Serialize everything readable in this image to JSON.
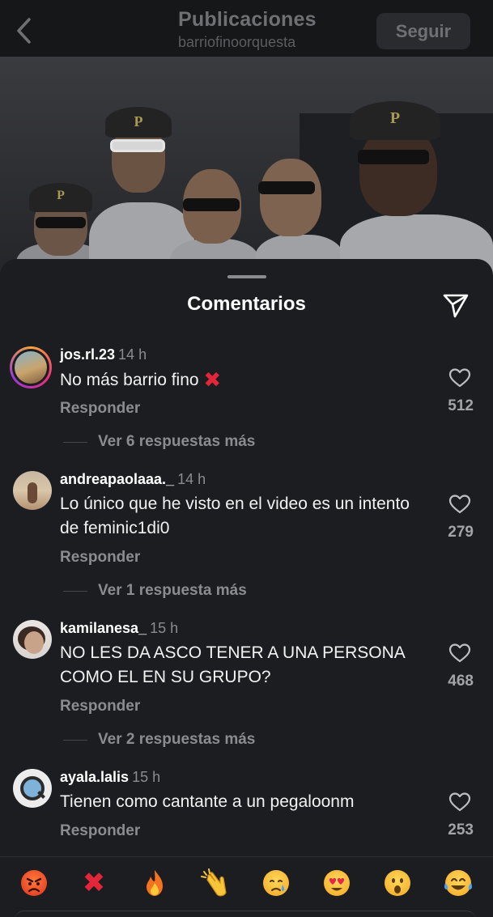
{
  "header": {
    "title": "Publicaciones",
    "subtitle": "barriofinoorquesta",
    "follow_label": "Seguir"
  },
  "sheet": {
    "title": "Comentarios"
  },
  "comments": [
    {
      "user": "jos.rl.23",
      "time": "14 h",
      "text": "No más barrio fino",
      "has_x_emoji": true,
      "reply_label": "Responder",
      "more_label": "Ver 6 respuestas más",
      "likes": "512"
    },
    {
      "user": "andreapaolaaa._",
      "time": "14 h",
      "text": "Lo único que he visto en el video es un intento de feminic1di0",
      "reply_label": "Responder",
      "more_label": "Ver 1 respuesta más",
      "likes": "279"
    },
    {
      "user": "kamilanesa_",
      "time": "15 h",
      "text": "NO LES DA ASCO TENER A UNA PERSONA COMO EL EN SU GRUPO?",
      "reply_label": "Responder",
      "more_label": "Ver 2 respuestas más",
      "likes": "468"
    },
    {
      "user": "ayala.lalis",
      "time": "15 h",
      "text": "Tienen como cantante a un pegaloonm",
      "reply_label": "Responder",
      "likes": "253"
    }
  ],
  "emoji_bar": [
    "angry-face",
    "cross-mark",
    "fire",
    "clapping-hands",
    "crying-face",
    "heart-eyes",
    "surprised-face",
    "tears-of-joy"
  ],
  "colors": {
    "background": "#1c1d21",
    "accent_red": "#e3263a",
    "muted_text": "#8b8c90"
  }
}
